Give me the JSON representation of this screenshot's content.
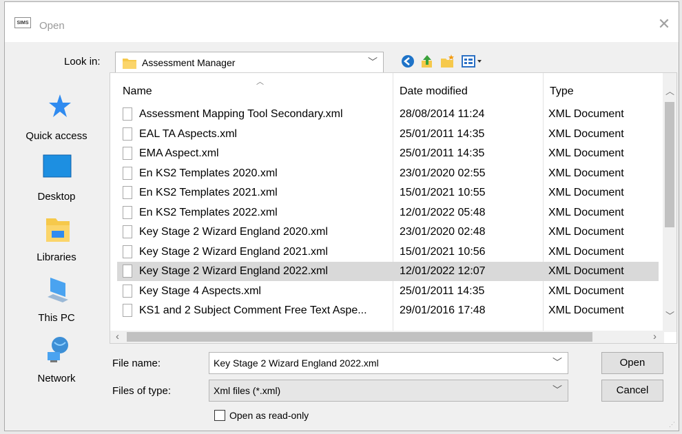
{
  "window": {
    "title": "Open",
    "app_icon_text": "SIMS"
  },
  "look_in": {
    "label": "Look in:",
    "value": "Assessment Manager"
  },
  "toolbar": {
    "icons": [
      "back-icon",
      "up-folder-icon",
      "new-folder-icon",
      "view-menu-icon"
    ]
  },
  "places": [
    {
      "label": "Quick access",
      "icon": "star-icon"
    },
    {
      "label": "Desktop",
      "icon": "desktop-icon"
    },
    {
      "label": "Libraries",
      "icon": "libraries-icon"
    },
    {
      "label": "This PC",
      "icon": "computer-icon"
    },
    {
      "label": "Network",
      "icon": "network-icon"
    }
  ],
  "columns": {
    "name": "Name",
    "date": "Date modified",
    "type": "Type"
  },
  "files": [
    {
      "name": "Assessment Mapping Tool Secondary.xml",
      "date": "28/08/2014 11:24",
      "type": "XML Document"
    },
    {
      "name": "EAL TA Aspects.xml",
      "date": "25/01/2011 14:35",
      "type": "XML Document"
    },
    {
      "name": "EMA Aspect.xml",
      "date": "25/01/2011 14:35",
      "type": "XML Document"
    },
    {
      "name": "En KS2 Templates 2020.xml",
      "date": "23/01/2020 02:55",
      "type": "XML Document"
    },
    {
      "name": "En KS2 Templates 2021.xml",
      "date": "15/01/2021 10:55",
      "type": "XML Document"
    },
    {
      "name": "En KS2 Templates 2022.xml",
      "date": "12/01/2022 05:48",
      "type": "XML Document"
    },
    {
      "name": "Key Stage 2 Wizard England 2020.xml",
      "date": "23/01/2020 02:48",
      "type": "XML Document"
    },
    {
      "name": "Key Stage 2 Wizard England 2021.xml",
      "date": "15/01/2021 10:56",
      "type": "XML Document"
    },
    {
      "name": "Key Stage 2 Wizard England 2022.xml",
      "date": "12/01/2022 12:07",
      "type": "XML Document",
      "selected": true
    },
    {
      "name": "Key Stage 4 Aspects.xml",
      "date": "25/01/2011 14:35",
      "type": "XML Document"
    },
    {
      "name": "KS1 and 2 Subject Comment Free Text Aspe...",
      "date": "29/01/2016 17:48",
      "type": "XML Document"
    }
  ],
  "file_name": {
    "label": "File name:",
    "value": "Key Stage 2 Wizard England 2022.xml"
  },
  "file_type": {
    "label": "Files of type:",
    "value": "Xml files (*.xml)"
  },
  "read_only": {
    "label": "Open as read-only",
    "checked": false
  },
  "buttons": {
    "open": "Open",
    "cancel": "Cancel"
  },
  "colors": {
    "accent": "#0078d7",
    "selected_row": "#d9d9d9",
    "folder": "#f6c94b"
  }
}
